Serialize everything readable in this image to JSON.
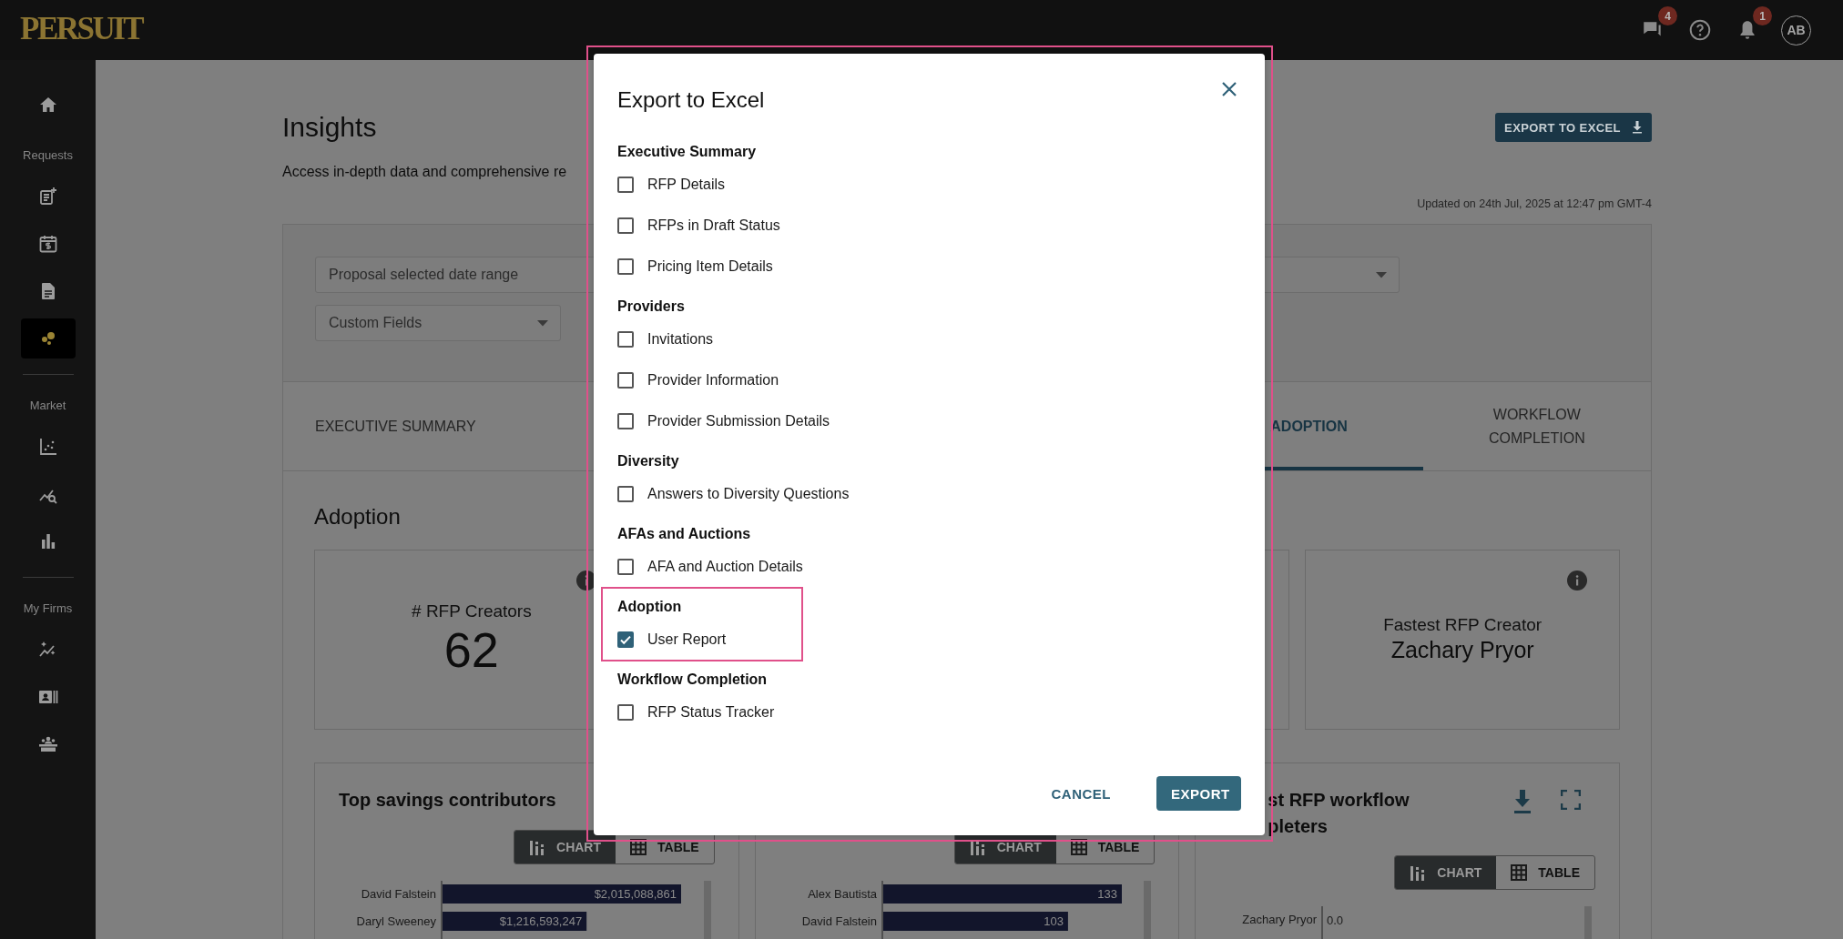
{
  "app": {
    "logo": "PERSUIT"
  },
  "top_bar": {
    "messages_badge": "4",
    "notifications_badge": "1",
    "avatar": "AB"
  },
  "sidebar": {
    "groups": [
      {
        "items": [
          {
            "selected": false
          }
        ]
      },
      {
        "label": "Requests",
        "items": [
          {
            "selected": false
          },
          {
            "selected": false
          },
          {
            "selected": false
          },
          {
            "selected": true
          }
        ]
      },
      {
        "label": "Market",
        "items": [
          {
            "selected": false
          },
          {
            "selected": false
          },
          {
            "selected": false
          }
        ]
      },
      {
        "label": "My Firms",
        "items": [
          {
            "selected": false
          },
          {
            "selected": false
          },
          {
            "selected": false
          }
        ]
      }
    ]
  },
  "page": {
    "title": "Insights",
    "description": "Access in-depth data and comprehensive re",
    "export_button": "EXPORT TO EXCEL",
    "updated": "Updated on 24th Jul, 2025 at 12:47 pm GMT-4"
  },
  "filters": [
    {
      "kind": "wide",
      "placeholder": "Proposal selected date range"
    },
    {
      "kind": "narrow",
      "placeholder": "Custom Fields"
    }
  ],
  "tabs": [
    {
      "label": "EXECUTIVE SUMMARY",
      "selected": false
    },
    {
      "label": "ADOPTION",
      "selected": true
    },
    {
      "label": "WORKFLOW COMPLETION",
      "selected": false
    }
  ],
  "section": {
    "title": "Adoption",
    "stat_cards": [
      {
        "kind": "number",
        "label": "# RFP Creators",
        "value": "62"
      },
      {
        "kind": "name",
        "label": "Fastest RFP Creator",
        "value": "Zachary Pryor"
      }
    ],
    "chart_cards": [
      {
        "title_lines": [
          "Top savings contributors"
        ],
        "view_toggle": [
          {
            "label": "CHART",
            "selected": true
          },
          {
            "label": "TABLE",
            "selected": false
          }
        ],
        "chart_data": {
          "type": "bar",
          "orientation": "horizontal",
          "categories": [
            "David Falstein",
            "Daryl Sweeney"
          ],
          "values": [
            2015088861,
            1216593247
          ],
          "value_labels": [
            "$2,015,088,861",
            "$1,216,593,247"
          ]
        }
      },
      {
        "view_toggle": [
          {
            "label": "CHART",
            "selected": true
          },
          {
            "label": "TABLE",
            "selected": false
          }
        ],
        "chart_data": {
          "type": "bar",
          "orientation": "horizontal",
          "categories": [
            "Alex Bautista",
            "David Falstein"
          ],
          "values": [
            133,
            103
          ],
          "value_labels": [
            "133",
            "103"
          ]
        }
      },
      {
        "title_lines": [
          "st RFP workflow",
          "pleters"
        ],
        "actions": true,
        "view_toggle": [
          {
            "label": "CHART",
            "selected": true
          },
          {
            "label": "TABLE",
            "selected": false
          }
        ],
        "rows": [
          {
            "name": "Zachary Pryor",
            "value": "0.0"
          }
        ]
      }
    ]
  },
  "dialog": {
    "title": "Export to Excel",
    "highlighted": true,
    "groups": [
      {
        "heading": "Executive Summary",
        "highlighted": false,
        "options": [
          {
            "label": "RFP Details",
            "checked": false
          },
          {
            "label": "RFPs in Draft Status",
            "checked": false
          },
          {
            "label": "Pricing Item Details",
            "checked": false
          }
        ]
      },
      {
        "heading": "Providers",
        "highlighted": false,
        "options": [
          {
            "label": "Invitations",
            "checked": false
          },
          {
            "label": "Provider Information",
            "checked": false
          },
          {
            "label": "Provider Submission Details",
            "checked": false
          }
        ]
      },
      {
        "heading": "Diversity",
        "highlighted": false,
        "options": [
          {
            "label": "Answers to Diversity Questions",
            "checked": false
          }
        ]
      },
      {
        "heading": "AFAs and Auctions",
        "highlighted": false,
        "options": [
          {
            "label": "AFA and Auction Details",
            "checked": false
          }
        ]
      },
      {
        "heading": "Adoption",
        "highlighted": true,
        "options": [
          {
            "label": "User Report",
            "checked": true
          }
        ]
      },
      {
        "heading": "Workflow Completion",
        "highlighted": false,
        "options": [
          {
            "label": "RFP Status Tracker",
            "checked": false
          }
        ]
      }
    ],
    "buttons": [
      {
        "kind": "text",
        "label": "CANCEL"
      },
      {
        "kind": "primary",
        "label": "EXPORT"
      }
    ]
  }
}
